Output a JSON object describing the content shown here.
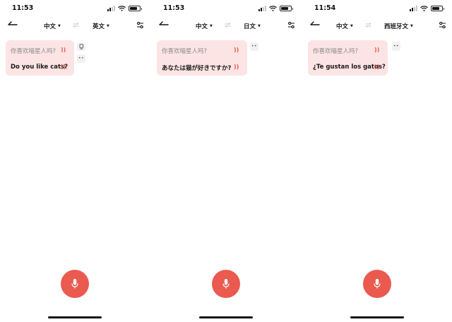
{
  "colors": {
    "accent": "#ea5a4f",
    "card_bg": "#fde4e4",
    "speaker": "#e4574a"
  },
  "screens": [
    {
      "time": "11:53",
      "source_lang": "中文",
      "target_lang": "英文",
      "source_text": "你喜欢喵星人吗?",
      "target_text": "Do you like cats?",
      "side_buttons": [
        "copy-icon",
        "more-icon"
      ]
    },
    {
      "time": "11:53",
      "source_lang": "中文",
      "target_lang": "日文",
      "source_text": "你喜欢喵星人吗?",
      "target_text": "あなたは猫が好きですか?",
      "side_buttons": [
        "more-icon"
      ]
    },
    {
      "time": "11:54",
      "source_lang": "中文",
      "target_lang": "西班牙文",
      "source_text": "你喜欢喵星人吗?",
      "target_text": "¿Te gustan los gatos?",
      "side_buttons": [
        "more-icon"
      ]
    }
  ]
}
